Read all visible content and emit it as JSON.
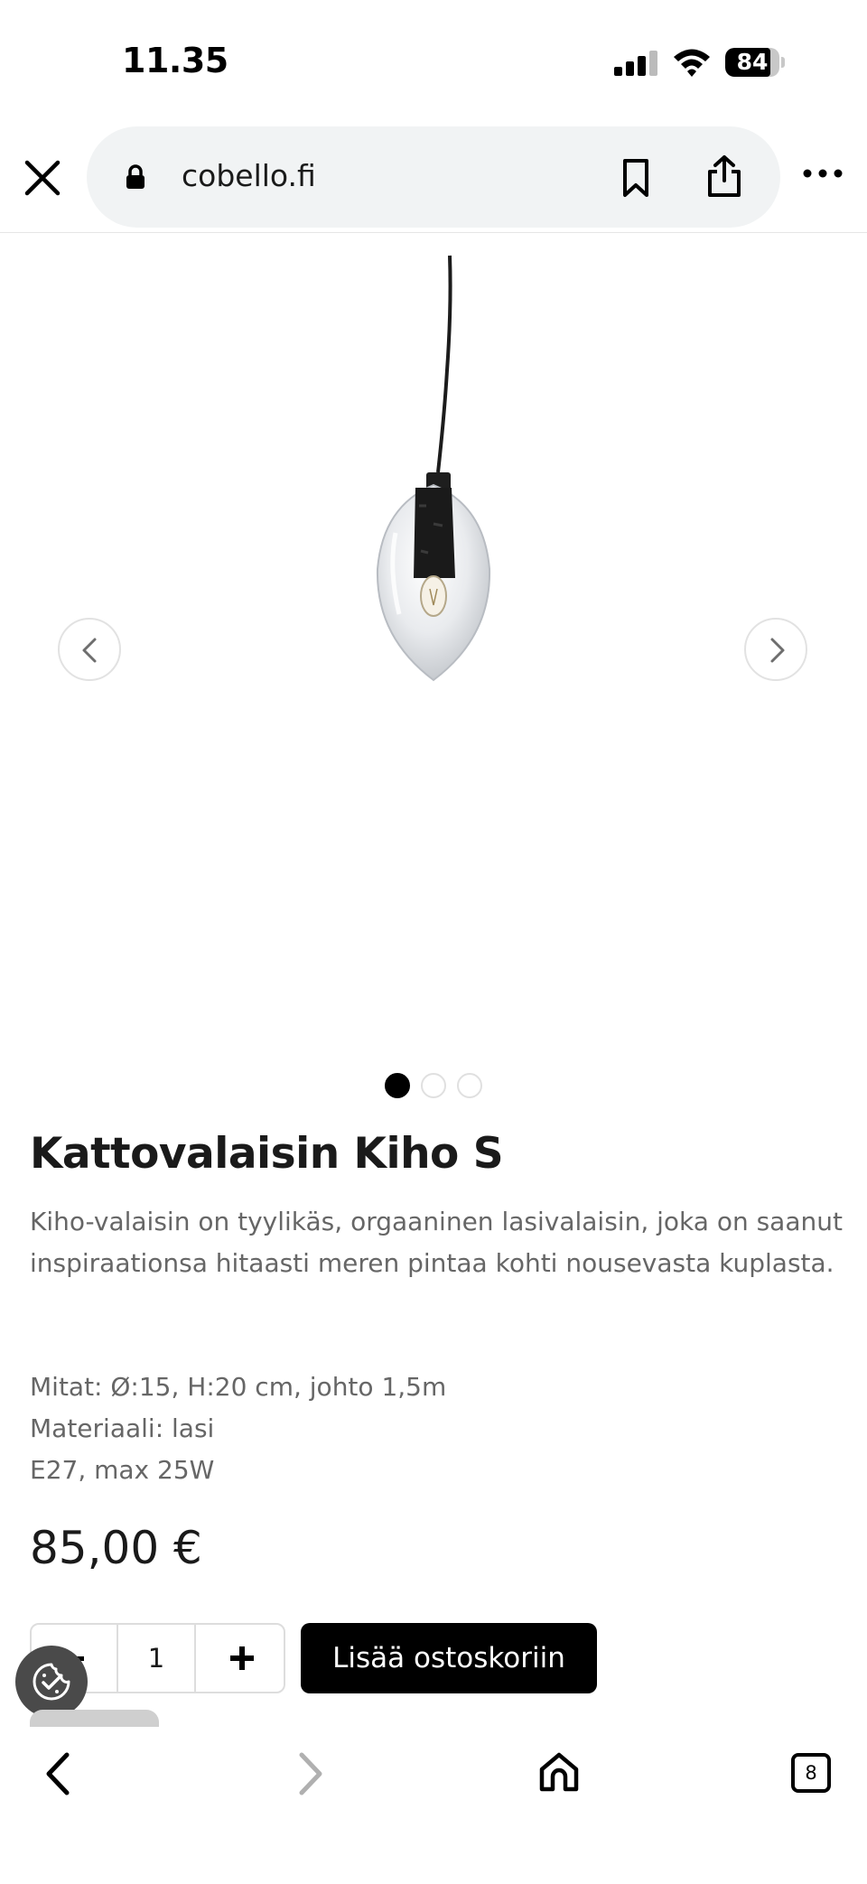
{
  "status_bar": {
    "time": "11.35",
    "battery_percent": "84",
    "battery_level": 0.84
  },
  "browser": {
    "url": "cobello.fi",
    "tab_count": "8",
    "icons": [
      "close-icon",
      "lock-icon",
      "bookmark-icon",
      "share-icon",
      "more-icon",
      "back-icon",
      "forward-icon",
      "home-icon",
      "tabs-icon"
    ]
  },
  "gallery": {
    "image_count": 3,
    "active_index": 0,
    "icons": [
      "chevron-left-icon",
      "chevron-right-icon"
    ]
  },
  "product": {
    "title": "Kattovalaisin Kiho S",
    "description": "Kiho-valaisin on tyylikäs, orgaaninen lasivalaisin, joka on saanut inspiraationsa hitaasti meren pintaa kohti nousevasta kuplasta.",
    "specs": [
      "Mitat: Ø:15, H:20 cm, johto 1,5m",
      "Materiaali: lasi",
      "E27, max 25W"
    ],
    "price": "85,00 €"
  },
  "cart": {
    "quantity": "1",
    "add_label": "Lisää ostoskoriin"
  },
  "colors": {
    "accent": "#000000",
    "text_muted": "#666666",
    "url_bar": "#f1f3f4"
  }
}
